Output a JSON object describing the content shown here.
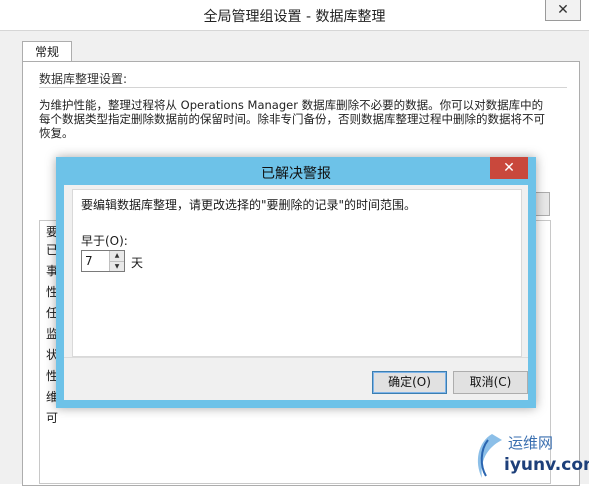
{
  "window": {
    "title": "全局管理组设置 - 数据库整理",
    "close_glyph": "✕"
  },
  "tabs": [
    {
      "label": "常规"
    }
  ],
  "section": {
    "title": "数据库整理设置:",
    "description": "为维护性能，整理过程将从 Operations Manager 数据库删除不必要的数据。你可以对数据库中的每个数据类型指定删除数据前的保留时间。除非专门备份，否则数据库整理过程中删除的数据将不可恢复。"
  },
  "list": {
    "header_partial": "要",
    "rows_partial": [
      "已",
      "事",
      "性",
      "任",
      "监",
      "状",
      "性",
      "维",
      "可"
    ]
  },
  "dialog": {
    "title": "已解决警报",
    "close_glyph": "✕",
    "message": "要编辑数据库整理，请更改选择的\"要删除的记录\"的时间范围。",
    "field_label": "早于(O):",
    "field_value": "7",
    "unit": "天",
    "ok_label": "确定(O)",
    "cancel_label": "取消(C)"
  },
  "watermark": {
    "cn": "运维网",
    "en": "iyunv.com"
  }
}
